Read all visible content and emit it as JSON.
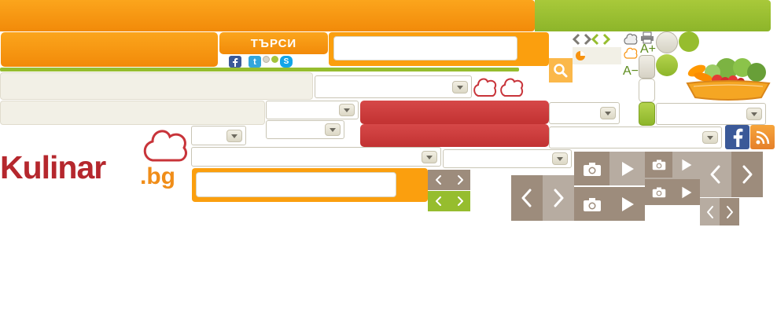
{
  "header": {
    "search_button_label": "ТЪРСИ"
  },
  "logo": {
    "name": "Kulinar",
    "suffix": ".bg"
  },
  "search": {
    "placeholder": ""
  },
  "text_size": {
    "increase": "A+",
    "decrease": "A−"
  },
  "colors": {
    "brand_orange": "#f7930f",
    "brand_green": "#96bd2e",
    "brand_red": "#c8343a",
    "cream": "#f2f0e6",
    "nav_brown": "#9d8c7c"
  },
  "icons": [
    "facebook-icon",
    "twitter-icon",
    "skype-icon",
    "search-icon",
    "chef-hat-icon",
    "camera-icon",
    "play-icon",
    "chevron-left-icon",
    "chevron-right-icon",
    "rss-icon",
    "print-icon",
    "pie-icon"
  ]
}
